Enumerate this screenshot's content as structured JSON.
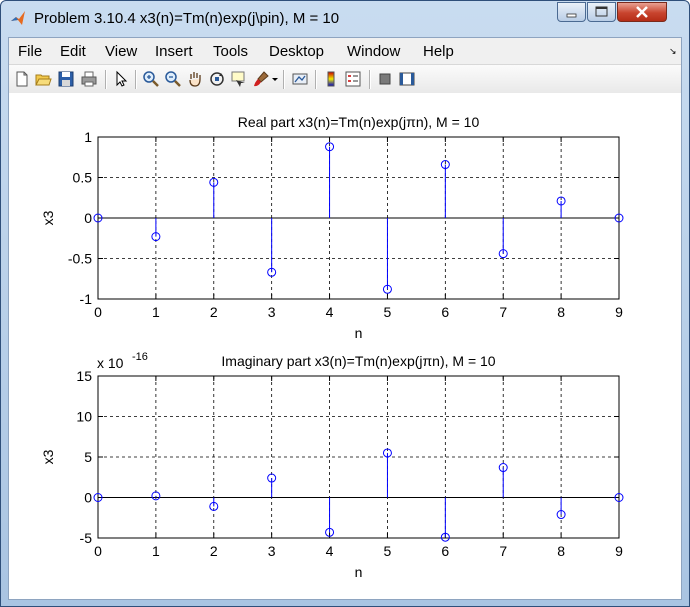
{
  "window": {
    "title": "Problem 3.10.4 x3(n)=Tm(n)exp(j\\pin), M = 10"
  },
  "menu": {
    "items": [
      "File",
      "Edit",
      "View",
      "Insert",
      "Tools",
      "Desktop",
      "Window",
      "Help"
    ]
  },
  "toolbar": {
    "icons": [
      "new-figure-icon",
      "open-file-icon",
      "save-icon",
      "print-icon",
      "arrow-pointer-icon",
      "zoom-in-icon",
      "zoom-out-icon",
      "pan-hand-icon",
      "rotate-3d-icon",
      "data-cursor-icon",
      "brush-icon",
      "dropdown-arrow-icon",
      "link-plot-icon",
      "colorbar-icon",
      "legend-icon",
      "hide-plot-tools-icon",
      "show-plot-tools-icon"
    ]
  },
  "colors": {
    "stem": "#0000ff",
    "axis": "#000000",
    "grid": "#000000"
  },
  "chart_data": [
    {
      "type": "stem",
      "title": "Real part x3(n)=Tm(n)exp(jπn), M = 10",
      "xlabel": "n",
      "ylabel": "x3",
      "xlim": [
        0,
        9
      ],
      "ylim": [
        -1,
        1
      ],
      "xticks": [
        "0",
        "1",
        "2",
        "3",
        "4",
        "5",
        "6",
        "7",
        "8",
        "9"
      ],
      "yticks": [
        "-1",
        "-0.5",
        "0",
        "0.5",
        "1"
      ],
      "grid": true,
      "x": [
        0,
        1,
        2,
        3,
        4,
        5,
        6,
        7,
        8,
        9
      ],
      "values": [
        0,
        -0.23,
        0.44,
        -0.67,
        0.88,
        -0.88,
        0.66,
        -0.44,
        0.21,
        0
      ]
    },
    {
      "type": "stem",
      "title": "Imaginary part x3(n)=Tm(n)exp(jπn), M = 10",
      "xlabel": "n",
      "ylabel": "x3",
      "exponent_label": "x 10",
      "exponent": "-16",
      "xlim": [
        0,
        9
      ],
      "ylim": [
        -5,
        15
      ],
      "xticks": [
        "0",
        "1",
        "2",
        "3",
        "4",
        "5",
        "6",
        "7",
        "8",
        "9"
      ],
      "yticks": [
        "-5",
        "0",
        "5",
        "10",
        "15"
      ],
      "grid": true,
      "x": [
        0,
        1,
        2,
        3,
        4,
        5,
        6,
        7,
        8,
        9
      ],
      "values": [
        0,
        0.2,
        -1.1,
        2.4,
        -4.3,
        5.5,
        -4.9,
        3.7,
        -2.1,
        0
      ]
    }
  ]
}
